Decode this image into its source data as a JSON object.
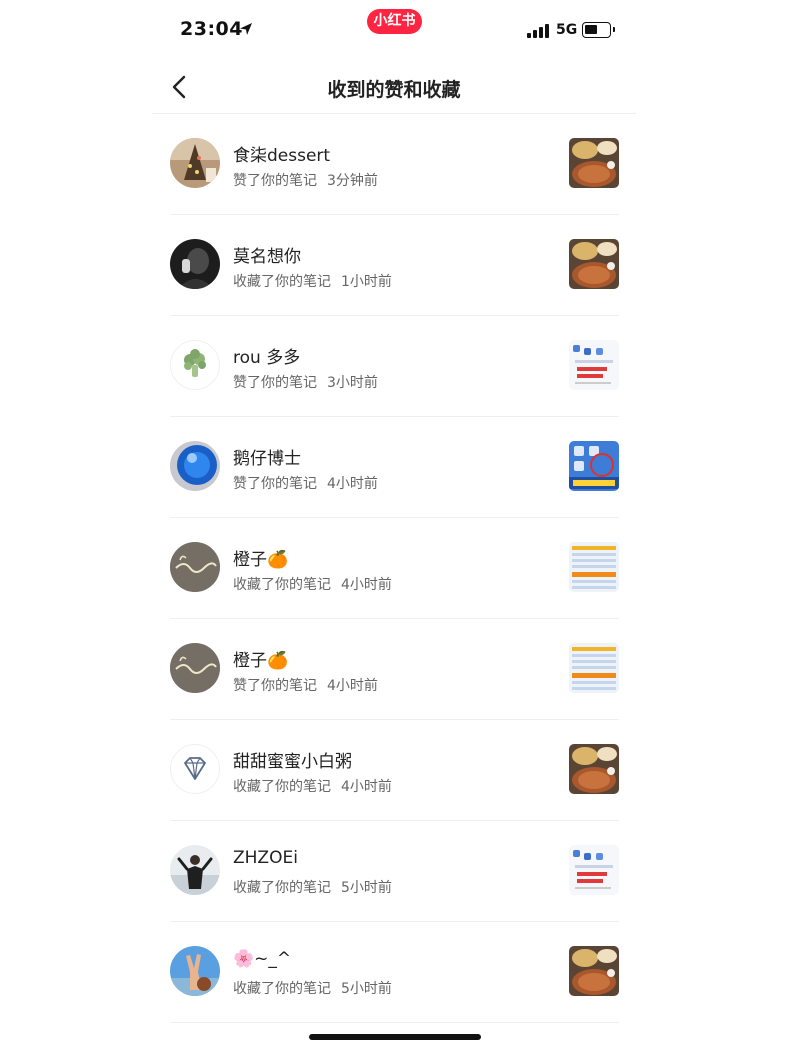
{
  "status_bar": {
    "time": "23:04",
    "app_badge": "小红书",
    "network": "5G"
  },
  "header": {
    "title": "收到的赞和收藏"
  },
  "notifications": [
    {
      "name": "食柒dessert",
      "action": "赞了你的笔记",
      "time": "3分钟前",
      "avatar_icon": "christmas-tree-photo",
      "thumb_icon": "food-photo"
    },
    {
      "name": "莫名想你",
      "action": "收藏了你的笔记",
      "time": "1小时前",
      "avatar_icon": "dark-portrait-photo",
      "thumb_icon": "food-photo"
    },
    {
      "name": "rou 多多",
      "action": "赞了你的笔记",
      "time": "3小时前",
      "avatar_icon": "broccoli-icon",
      "thumb_icon": "app-screenshot"
    },
    {
      "name": "鹅仔博士",
      "action": "赞了你的笔记",
      "time": "4小时前",
      "avatar_icon": "blue-sphere-photo",
      "thumb_icon": "ev-card-screenshot"
    },
    {
      "name": "橙子🍊",
      "action": "收藏了你的笔记",
      "time": "4小时前",
      "avatar_icon": "neon-sign-photo",
      "thumb_icon": "table-screenshot"
    },
    {
      "name": "橙子🍊",
      "action": "赞了你的笔记",
      "time": "4小时前",
      "avatar_icon": "neon-sign-photo",
      "thumb_icon": "table-screenshot"
    },
    {
      "name": "甜甜蜜蜜小白粥",
      "action": "收藏了你的笔记",
      "time": "4小时前",
      "avatar_icon": "diamond-icon",
      "thumb_icon": "food-photo"
    },
    {
      "name": "ZHZOEi",
      "action": "收藏了你的笔记",
      "time": "5小时前",
      "avatar_icon": "person-photo",
      "thumb_icon": "app-screenshot"
    },
    {
      "name": "🌸~_^",
      "action": "收藏了你的笔记",
      "time": "5小时前",
      "avatar_icon": "peace-hand-photo",
      "thumb_icon": "food-photo"
    }
  ],
  "colors": {
    "brand": "#ff2442",
    "text_primary": "#222222",
    "text_secondary": "#666666",
    "divider": "#efefef"
  }
}
